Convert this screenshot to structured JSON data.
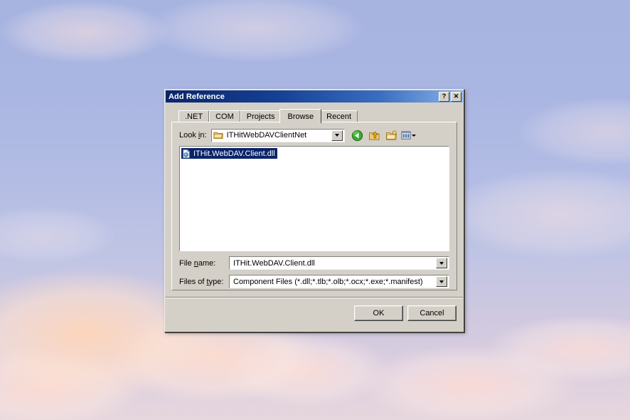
{
  "desktop": {
    "wallpaper_name": "sky-clouds-wallpaper",
    "sky_color": "#aab6e2",
    "cloud_color": "#ffd8c4"
  },
  "dialog": {
    "title": "Add Reference",
    "titlebar_gradient_start": "#0a246a",
    "titlebar_gradient_end": "#8ab3e8",
    "help_button_label": "?",
    "close_button_label": "✕",
    "tabs": [
      {
        "label": ".NET",
        "active": false
      },
      {
        "label": "COM",
        "active": false
      },
      {
        "label": "Projects",
        "active": false
      },
      {
        "label": "Browse",
        "active": true
      },
      {
        "label": "Recent",
        "active": false
      }
    ],
    "browse_page": {
      "look_in": {
        "label_prefix": "Look ",
        "label_accel": "i",
        "label_suffix": "n:",
        "value": "ITHitWebDAVClientNet",
        "folder_icon": "folder-icon"
      },
      "toolbar": [
        {
          "name": "back-icon",
          "tooltip": "Back"
        },
        {
          "name": "up-one-level-icon",
          "tooltip": "Up One Level"
        },
        {
          "name": "new-folder-icon",
          "tooltip": "Create New Folder"
        },
        {
          "name": "views-icon",
          "tooltip": "Views"
        }
      ],
      "files": [
        {
          "name": "ITHit.WebDAV.Client.dll",
          "icon": "dll-file-icon",
          "selected": true
        }
      ],
      "selection_color": "#0a246a",
      "file_name": {
        "label_prefix": "File ",
        "label_accel": "n",
        "label_suffix": "ame:",
        "value": "ITHit.WebDAV.Client.dll"
      },
      "files_of_type": {
        "label_prefix": "Files of ",
        "label_accel": "t",
        "label_suffix": "ype:",
        "value": "Component Files (*.dll;*.tlb;*.olb;*.ocx;*.exe;*.manifest)"
      }
    },
    "buttons": {
      "ok": "OK",
      "cancel": "Cancel"
    }
  }
}
